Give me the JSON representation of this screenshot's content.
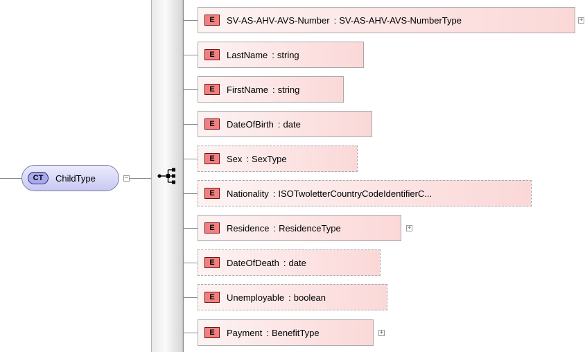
{
  "root": {
    "badge": "CT",
    "name": "ChildType"
  },
  "elements": [
    {
      "badge": "E",
      "name": "SV-AS-AHV-AVS-Number",
      "separator": ":",
      "type": "SV-AS-AHV-AVS-NumberType",
      "optional": false,
      "expandable": true
    },
    {
      "badge": "E",
      "name": "LastName",
      "separator": ":",
      "type": "string",
      "optional": false,
      "expandable": false
    },
    {
      "badge": "E",
      "name": "FirstName",
      "separator": ":",
      "type": "string",
      "optional": false,
      "expandable": false
    },
    {
      "badge": "E",
      "name": "DateOfBirth",
      "separator": ":",
      "type": "date",
      "optional": false,
      "expandable": false
    },
    {
      "badge": "E",
      "name": "Sex",
      "separator": ":",
      "type": "SexType",
      "optional": true,
      "expandable": false
    },
    {
      "badge": "E",
      "name": "Nationality",
      "separator": ":",
      "type": "ISOTwoletterCountryCodeIdentifierC...",
      "optional": true,
      "expandable": false
    },
    {
      "badge": "E",
      "name": "Residence",
      "separator": ":",
      "type": "ResidenceType",
      "optional": false,
      "expandable": true
    },
    {
      "badge": "E",
      "name": "DateOfDeath",
      "separator": ":",
      "type": "date",
      "optional": true,
      "expandable": false
    },
    {
      "badge": "E",
      "name": "Unemployable",
      "separator": ":",
      "type": "boolean",
      "optional": true,
      "expandable": false
    },
    {
      "badge": "E",
      "name": "Payment",
      "separator": ":",
      "type": "BenefitType",
      "optional": false,
      "expandable": true
    }
  ],
  "toggle_symbols": {
    "collapse": "−",
    "expand": "+"
  },
  "colors": {
    "element_fill": "#fbd8d8",
    "element_badge": "#f08080",
    "type_node_fill": "#c8c8f2",
    "type_badge": "#a9a9ee",
    "connector": "#8a8a8a"
  }
}
